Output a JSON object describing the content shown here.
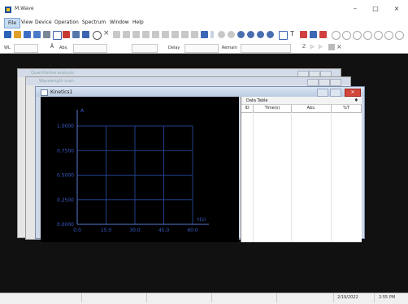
{
  "app": {
    "title": "M.Wave"
  },
  "window_controls": {
    "minimize": "–",
    "maximize": "□",
    "close": "×"
  },
  "menu": [
    "File",
    "View",
    "Device",
    "Operation",
    "Spectrum",
    "Window",
    "Help"
  ],
  "fields": {
    "wl_label": "WL",
    "abs_label": "Abs.",
    "abs_value": "",
    "delay_label": "Delay",
    "remain_label": "Remain"
  },
  "windows": {
    "back1_title": "Quantitative analysis",
    "back2_title": "Wavelength scan",
    "front_title": "Kinetics1"
  },
  "chart_data": {
    "type": "line",
    "ylabel": "A",
    "xlabel": "t(s)",
    "y_ticks": [
      "1.0000",
      "0.7500",
      "0.5000",
      "0.2500",
      "0.0000"
    ],
    "x_ticks": [
      "0.0",
      "15.0",
      "30.0",
      "45.0",
      "60.0"
    ],
    "xlim": [
      0,
      60
    ],
    "ylim": [
      0,
      1
    ],
    "grid": true,
    "series": []
  },
  "data_table": {
    "title": "Data Table",
    "pin": "♦",
    "columns": [
      "ID",
      "Time(s)",
      "Abs.",
      "%T"
    ],
    "rows": []
  },
  "status": {
    "date": "2/19/2022",
    "time": "2:55 PM"
  }
}
